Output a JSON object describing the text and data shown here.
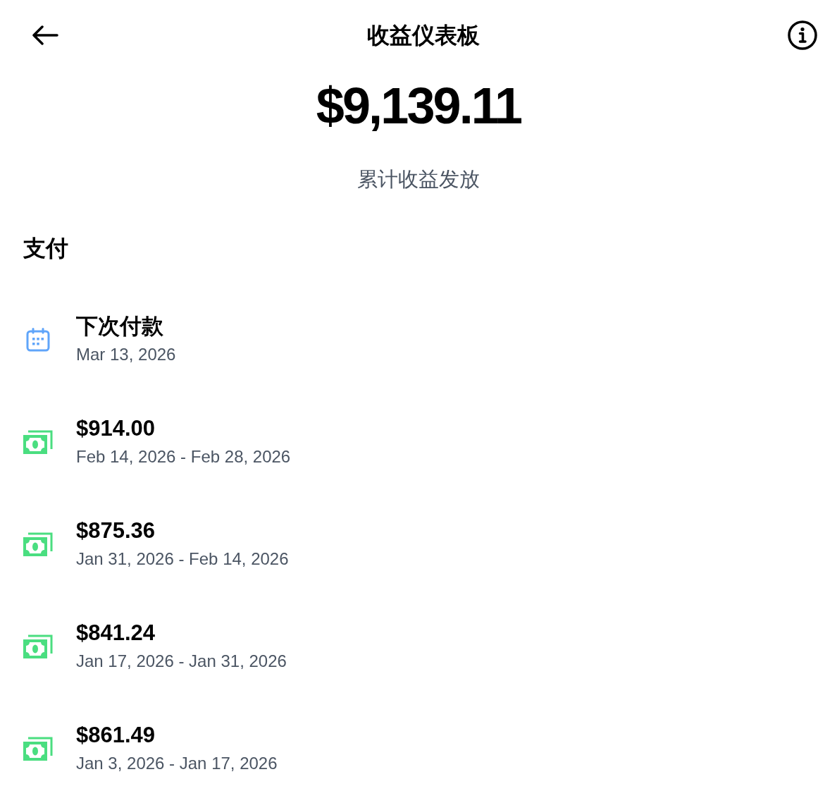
{
  "header": {
    "title": "收益仪表板"
  },
  "summary": {
    "amount": "$9,139.11",
    "caption": "累计收益发放"
  },
  "section": {
    "title": "支付"
  },
  "payments": [
    {
      "kind": "scheduled",
      "title": "下次付款",
      "date": "Mar 13, 2026"
    },
    {
      "kind": "payout",
      "title": "$914.00",
      "date": "Feb 14, 2026 - Feb 28, 2026"
    },
    {
      "kind": "payout",
      "title": "$875.36",
      "date": "Jan 31, 2026 - Feb 14, 2026"
    },
    {
      "kind": "payout",
      "title": "$841.24",
      "date": "Jan 17, 2026 - Jan 31, 2026"
    },
    {
      "kind": "payout",
      "title": "$861.49",
      "date": "Jan 3, 2026 - Jan 17, 2026"
    }
  ]
}
